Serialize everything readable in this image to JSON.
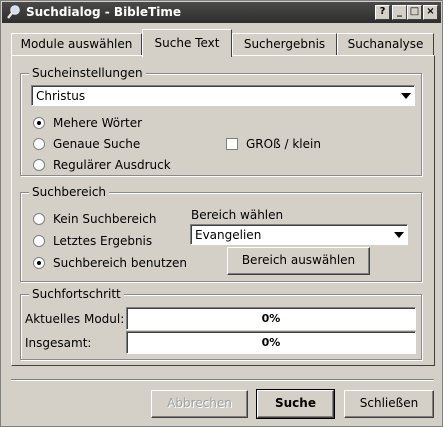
{
  "window": {
    "title": "Suchdialog - BibleTime",
    "controls": [
      "?",
      "_",
      "□",
      "×"
    ]
  },
  "tabs": [
    {
      "label": "Module auswählen",
      "active": false
    },
    {
      "label": "Suche Text",
      "active": true
    },
    {
      "label": "Suchergebnis",
      "active": false
    },
    {
      "label": "Suchanalyse",
      "active": false
    }
  ],
  "search_settings": {
    "title": "Sucheinstellungen",
    "query": "Christus",
    "modes": [
      {
        "label": "Mehere Wörter",
        "selected": true
      },
      {
        "label": "Genaue Suche",
        "selected": false
      },
      {
        "label": "Regulärer Ausdruck",
        "selected": false
      }
    ],
    "case_label": "GROß / klein",
    "case_checked": false
  },
  "scope": {
    "title": "Suchbereich",
    "options": [
      {
        "label": "Kein Suchbereich",
        "selected": false
      },
      {
        "label": "Letztes Ergebnis",
        "selected": false
      },
      {
        "label": "Suchbereich benutzen",
        "selected": true
      }
    ],
    "choose_label": "Bereich wählen",
    "selected_range": "Evangelien",
    "select_button": "Bereich auswählen"
  },
  "progress": {
    "title": "Suchfortschritt",
    "current_label": "Aktuelles Modul:",
    "current_value": 0,
    "current_text": "0%",
    "total_label": "Insgesamt:",
    "total_value": 0,
    "total_text": "0%"
  },
  "buttons": {
    "cancel": "Abbrechen",
    "search": "Suche",
    "close": "Schließen"
  }
}
